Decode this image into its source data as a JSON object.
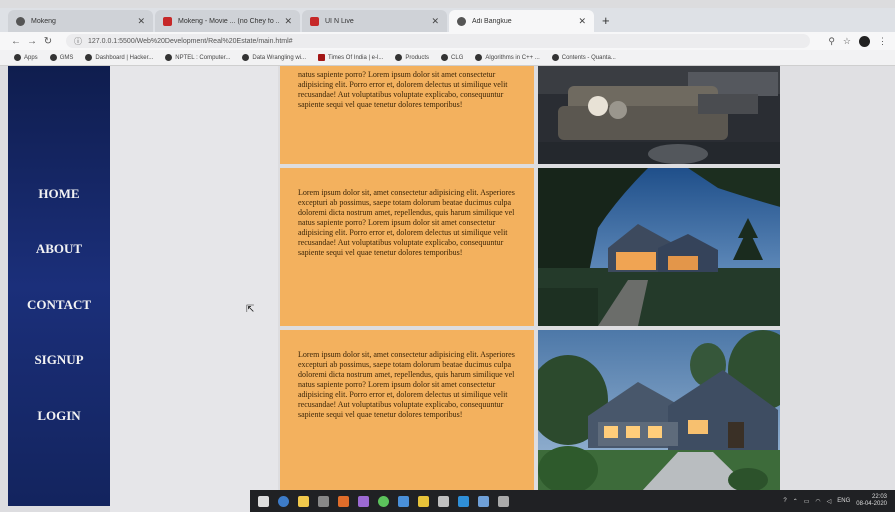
{
  "browser": {
    "tabs": [
      {
        "title": "Mokeng",
        "favicon": "globe-icon",
        "active": false
      },
      {
        "title": "Mokeng - Movie ... (no Chey fo ...",
        "favicon": "youtube-icon",
        "active": false
      },
      {
        "title": "UI N Live",
        "favicon": "youtube-icon",
        "active": false
      },
      {
        "title": "Adi Bangkue",
        "favicon": "globe-icon",
        "active": true
      }
    ],
    "url": "127.0.0.1:5500/Web%20Development/Real%20Estate/main.html#",
    "bookmarks": [
      "Apps",
      "GMS",
      "Dashboard | Hacker...",
      "NPTEL : Computer...",
      "Data Wrangling wi...",
      "Times Of India | e-l...",
      "Products",
      "CLG",
      "Algorithms in C++ ...",
      "Contents - Quanta..."
    ]
  },
  "sidebar": {
    "items": [
      "HOME",
      "ABOUT",
      "CONTACT",
      "SIGNUP",
      "LOGIN"
    ]
  },
  "listings": [
    {
      "text": "natus sapiente porro? Lorem ipsum dolor sit amet consectetur adipisicing elit. Porro error et, dolorem delectus ut similique velit recusandae! Aut voluptatibus voluptate explicabo, consequuntur sapiente sequi vel quae tenetur dolores temporibus!"
    },
    {
      "text": "Lorem ipsum dolor sit, amet consectetur adipisicing elit. Asperiores excepturi ab possimus, saepe totam dolorum beatae ducimus culpa doloremi dicta nostrum amet, repellendus, quis harum similique vel natus sapiente porro? Lorem ipsum dolor sit amet consectetur adipisicing elit. Porro error et, dolorem delectus ut similique velit recusandae! Aut voluptatibus voluptate explicabo, consequuntur sapiente sequi vel quae tenetur dolores temporibus!"
    },
    {
      "text": "Lorem ipsum dolor sit, amet consectetur adipisicing elit. Asperiores excepturi ab possimus, saepe totam dolorum beatae ducimus culpa doloremi dicta nostrum amet, repellendus, quis harum similique vel natus sapiente porro? Lorem ipsum dolor sit amet consectetur adipisicing elit. Porro error et, dolorem delectus ut similique velit recusandae! Aut voluptatibus voluptate explicabo, consequuntur sapiente sequi vel quae tenetur dolores temporibus!"
    }
  ],
  "taskbar": {
    "language": "ENG",
    "time": "22:03",
    "date": "08-04-2020"
  },
  "colors": {
    "sidebar": "#1b2f7a",
    "listing_text_bg": "#f3b15e"
  }
}
